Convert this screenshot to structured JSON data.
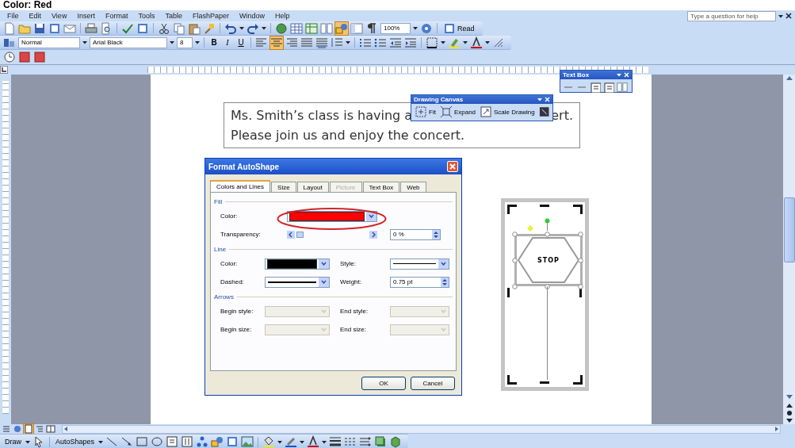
{
  "caption": "Color: Red",
  "menu": [
    "File",
    "Edit",
    "View",
    "Insert",
    "Format",
    "Tools",
    "Table",
    "FlashPaper",
    "Window",
    "Help"
  ],
  "help_box": {
    "placeholder": "Type a question for help"
  },
  "standard_toolbar": {
    "zoom": "100%",
    "read_button": "Read",
    "drawing_selected": true
  },
  "formatting_toolbar": {
    "style": "Normal",
    "font": "Arial Black",
    "size": "8",
    "bold": "B",
    "italic": "I",
    "underline": "U",
    "alignments": [
      {
        "selected": false
      },
      {
        "selected": true
      },
      {
        "selected": false
      },
      {
        "selected": false
      }
    ]
  },
  "text_box_toolbar": {
    "title": "Text Box"
  },
  "document": {
    "line_1_left": "Ms. Smith’s class is having a",
    "line_1_right": "ert.",
    "line_2": "Please join us and enjoy the concert."
  },
  "drawing_canvas_toolbar": {
    "title": "Drawing Canvas",
    "buttons": [
      "Fit",
      "Expand",
      "Scale Drawing"
    ]
  },
  "dialog": {
    "title": "Format AutoShape",
    "tabs": [
      {
        "label": "Colors and Lines",
        "selected": true,
        "disabled": false
      },
      {
        "label": "Size",
        "selected": false,
        "disabled": false
      },
      {
        "label": "Layout",
        "selected": false,
        "disabled": false
      },
      {
        "label": "Picture",
        "selected": false,
        "disabled": true
      },
      {
        "label": "Text Box",
        "selected": false,
        "disabled": false
      },
      {
        "label": "Web",
        "selected": false,
        "disabled": false
      }
    ],
    "fill": {
      "heading": "Fill",
      "color_label": "Color:",
      "color": "#ff0000",
      "transparency_label": "Transparency:",
      "transparency": {
        "level": 0
      },
      "transparency_value": "0 %"
    },
    "line": {
      "heading": "Line",
      "color_label": "Color:",
      "color": "#000000",
      "style_label": "Style:",
      "dashed_label": "Dashed:",
      "weight_label": "Weight:",
      "weight": "0.75 pt"
    },
    "arrows": {
      "heading": "Arrows",
      "fields": [
        {
          "label": "Begin style:",
          "disabled": true
        },
        {
          "label": "End style:",
          "disabled": true
        },
        {
          "label": "Begin size:",
          "disabled": true
        },
        {
          "label": "End size:",
          "disabled": true
        }
      ]
    },
    "buttons": [
      "OK",
      "Cancel"
    ]
  },
  "stop_sign": {
    "label": "STOP"
  },
  "view_buttons": [
    {
      "selected": false
    },
    {
      "selected": false
    },
    {
      "selected": true
    },
    {
      "selected": false
    },
    {
      "selected": false
    }
  ],
  "drawing_toolbar": {
    "draw": "Draw",
    "autoshapes": "AutoShapes"
  }
}
